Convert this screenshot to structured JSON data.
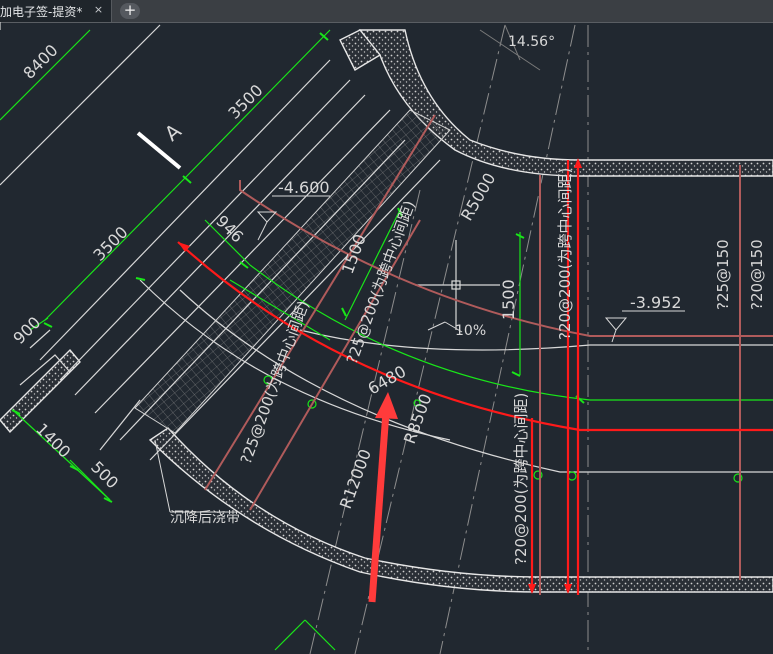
{
  "tab": {
    "title": "加电子签-提资*",
    "close_glyph": "×",
    "new_tab_glyph": "+"
  },
  "drawing": {
    "section_marker": "A",
    "dims": {
      "d8400": "8400",
      "d3500a": "3500",
      "d3500b": "3500",
      "d900": "900",
      "d1400": "1400",
      "d500": "500",
      "d946": "946",
      "d1500a": "1500",
      "d1500b": "1500",
      "d6480": "6480",
      "angle": "14.56°"
    },
    "levels": {
      "lvl1": "-4.600",
      "lvl2": "-3.952"
    },
    "radii": {
      "r5000": "R5000",
      "r8500": "R8500",
      "r12000": "R12000"
    },
    "slope": "10%",
    "rebar": {
      "r1": "?25@200(为跨中心间距)",
      "r2": "?25@200(为跨中心间距)",
      "r3": "?20@200(为跨中心间距)",
      "r4": "?20@200(为跨中心间距)",
      "r5": "?25@150",
      "r6": "?20@150"
    },
    "note": "沉降后浇带"
  },
  "colors": {
    "background": "#212830",
    "white_lines": "#d8d8d8",
    "green_dims": "#19e619",
    "red_line": "#ff1a1a",
    "rebar_brown": "#b05b5b",
    "arrow_red": "#ff3b3b"
  }
}
